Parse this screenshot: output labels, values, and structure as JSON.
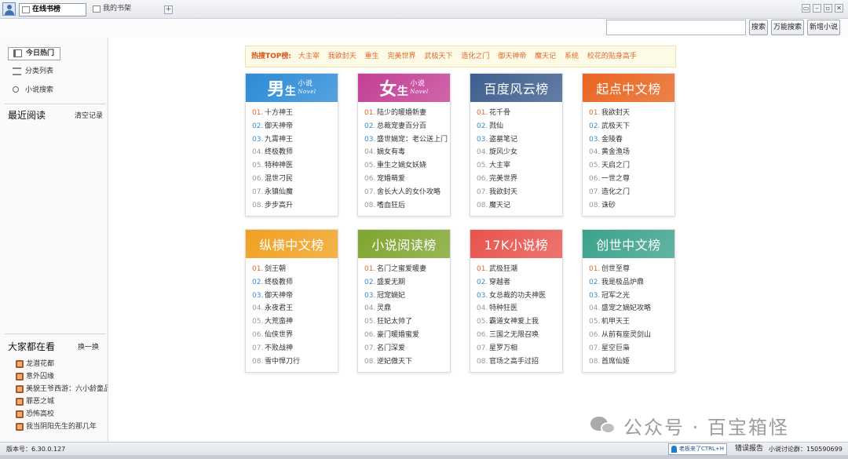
{
  "tabs": [
    {
      "label": "在线书榜",
      "active": true
    },
    {
      "label": "我的书架",
      "active": false
    }
  ],
  "window_buttons": [
    "▭",
    "–",
    "▫",
    "✕"
  ],
  "search": {
    "placeholder": "",
    "buttons": [
      "搜索",
      "万能搜索",
      "新增小说"
    ]
  },
  "sidebar": {
    "nav": [
      {
        "label": "今日热门",
        "icon": "book-icon",
        "active": true
      },
      {
        "label": "分类列表",
        "icon": "list-icon",
        "active": false
      },
      {
        "label": "小说搜索",
        "icon": "search-icon",
        "active": false
      }
    ],
    "recent": {
      "title": "最近阅读",
      "action": "清空记录"
    },
    "popular": {
      "title": "大家都在看",
      "action": "换一换",
      "items": [
        "龙潜花都",
        "意外囚缘",
        "美貌王爷西游：六小龄童品",
        "罪恶之城",
        "恐怖高校",
        "我当阴阳先生的那几年"
      ]
    }
  },
  "hot_bar": {
    "label": "热搜TOP榜:",
    "keywords": [
      "大主宰",
      "我欲封天",
      "重生",
      "完美世界",
      "武极天下",
      "造化之门",
      "御天神帝",
      "魔天记",
      "系统",
      "校花的贴身高手"
    ]
  },
  "cards": [
    {
      "id": "male",
      "style": "stylized",
      "big": "男",
      "mid": "生",
      "small": "小说",
      "sub": "Novel",
      "color": "#2c8bd6",
      "items": [
        "十方神王",
        "御天神帝",
        "九霄神王",
        "终极教师",
        "特种神医",
        "混世刁民",
        "永镇仙魔",
        "步步高升"
      ]
    },
    {
      "id": "female",
      "style": "stylized",
      "big": "女",
      "mid": "生",
      "small": "小说",
      "sub": "Novel",
      "color": "#c43f95",
      "items": [
        "陆少的暖婚新妻",
        "总裁宠妻百分百",
        "盛世嫡宠：老公送上门",
        "嫡女有毒",
        "重生之嫡女妖娆",
        "宠婚萌爱",
        "舍长大人的女仆攻略",
        "嗜血狂后"
      ]
    },
    {
      "id": "baidu",
      "style": "plain",
      "title": "百度风云榜",
      "color": "#3d5e8e",
      "items": [
        "花千骨",
        "戮仙",
        "盗墓笔记",
        "旋风少女",
        "大主宰",
        "完美世界",
        "我欲封天",
        "魔天记"
      ]
    },
    {
      "id": "qidian",
      "style": "plain",
      "title": "起点中文榜",
      "color": "#e8641f",
      "items": [
        "我欲封天",
        "武极天下",
        "金陵春",
        "黄金渔场",
        "天启之门",
        "一世之尊",
        "造化之门",
        "诛砂"
      ]
    },
    {
      "id": "zongheng",
      "style": "plain",
      "title": "纵横中文榜",
      "color": "#f0a020",
      "items": [
        "剑王朝",
        "终极教师",
        "御天神帝",
        "永夜君王",
        "大荒蛮神",
        "仙侠世界",
        "不败战神",
        "雪中悍刀行"
      ]
    },
    {
      "id": "xiaoshuo",
      "style": "plain",
      "title": "小说阅读榜",
      "color": "#7ea52e",
      "items": [
        "名门之蜜爱暖妻",
        "盛爱无期",
        "冠宠嫡妃",
        "灵鼎",
        "狂妃太帅了",
        "豪门暖婚蜜爱",
        "名门深爱",
        "逆妃傲天下"
      ]
    },
    {
      "id": "17k",
      "style": "plain",
      "title": "17K小说榜",
      "color": "#e8534c",
      "items": [
        "武极狂潮",
        "穿越者",
        "女总裁的功夫神医",
        "特种狂医",
        "霸道女神爱上我",
        "三国之无限召唤",
        "星罗万相",
        "官场之高手过招"
      ]
    },
    {
      "id": "chuangshi",
      "style": "plain",
      "title": "创世中文榜",
      "color": "#3aa28b",
      "items": [
        "创世至尊",
        "我是极品炉鼎",
        "冠军之光",
        "盛宠之嫡妃攻略",
        "机甲天王",
        "从前有座灵剑山",
        "星空巨枭",
        "首席仙姬"
      ]
    }
  ],
  "status": {
    "version": "版本号：6.30.0.127",
    "boss_key": "老板来了CTRL+H",
    "error_report": "错误报告",
    "qq_group": "小说讨论群：150590699"
  },
  "watermark": {
    "text": "公众号 · 百宝箱怪"
  }
}
